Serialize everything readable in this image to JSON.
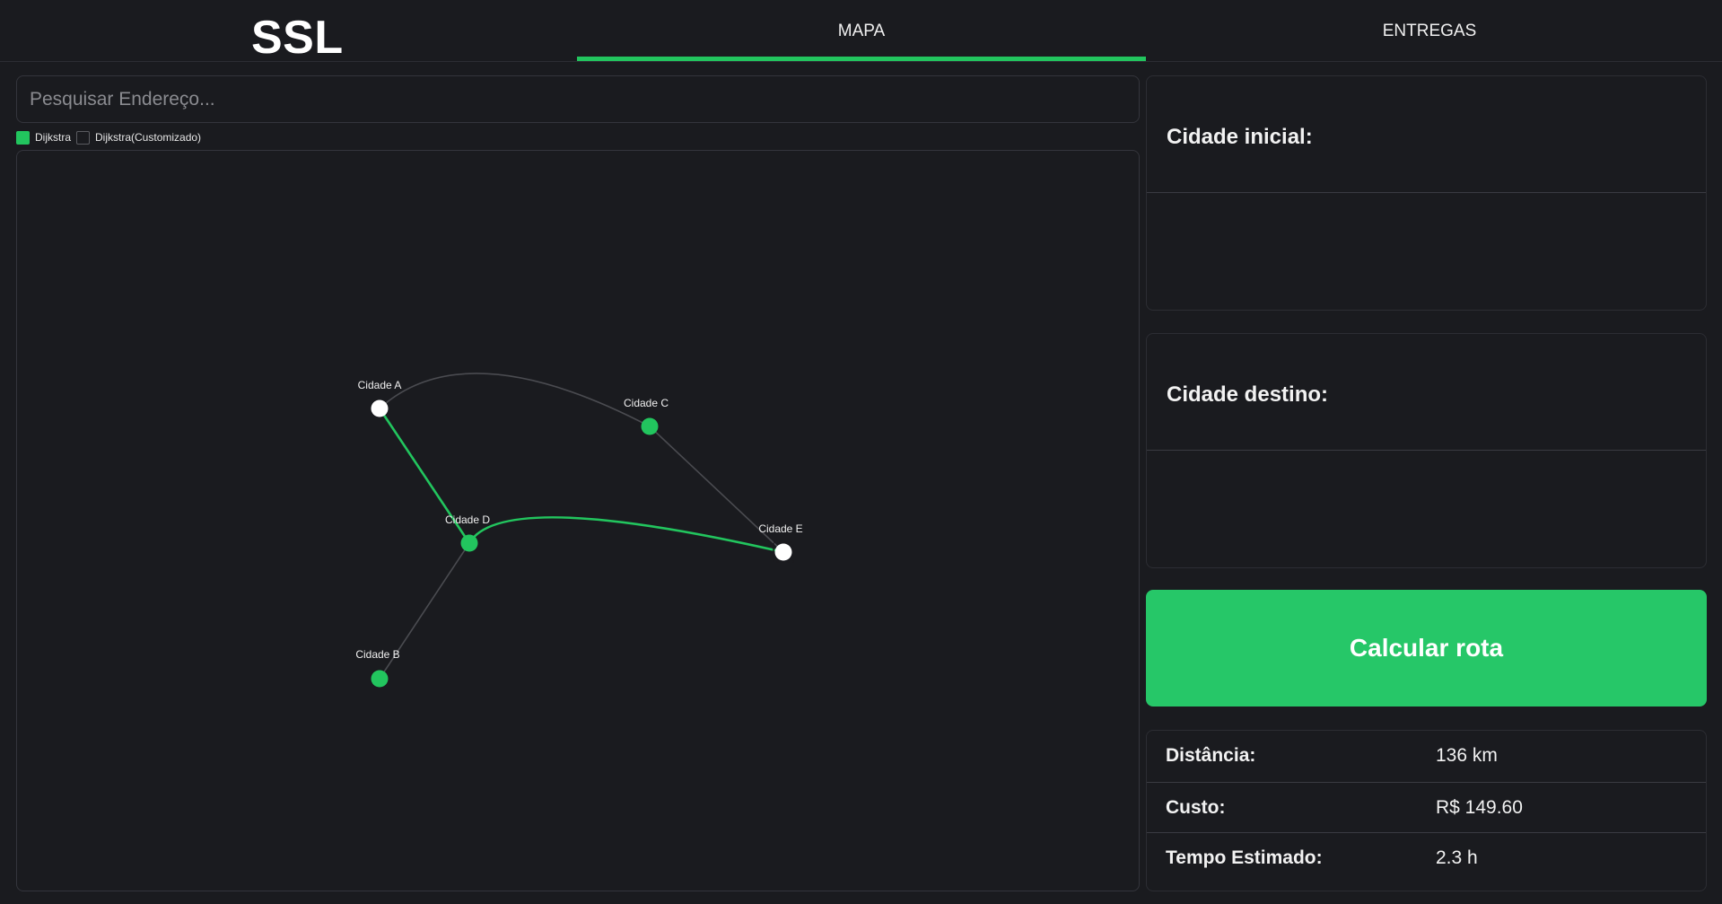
{
  "header": {
    "logo": "SSL",
    "tabs": [
      {
        "label": "MAPA",
        "active": true
      },
      {
        "label": "ENTREGAS",
        "active": false
      }
    ]
  },
  "search": {
    "placeholder": "Pesquisar Endereço...",
    "value": ""
  },
  "legend": [
    {
      "label": "Dijkstra",
      "checked": true,
      "color": "#22c55e"
    },
    {
      "label": "Dijkstra(Customizado)",
      "checked": false
    }
  ],
  "graph": {
    "nodes": [
      {
        "id": "A",
        "label": "Cidade A",
        "state": "selected"
      },
      {
        "id": "B",
        "label": "Cidade B",
        "state": "normal"
      },
      {
        "id": "C",
        "label": "Cidade C",
        "state": "normal"
      },
      {
        "id": "D",
        "label": "Cidade D",
        "state": "normal"
      },
      {
        "id": "E",
        "label": "Cidade E",
        "state": "selected-focused"
      }
    ],
    "edges": [
      {
        "from": "A",
        "to": "C",
        "on_path": false
      },
      {
        "from": "C",
        "to": "E",
        "on_path": false
      },
      {
        "from": "A",
        "to": "D",
        "on_path": true
      },
      {
        "from": "D",
        "to": "E",
        "on_path": true
      },
      {
        "from": "D",
        "to": "B",
        "on_path": false
      }
    ],
    "colors": {
      "path": "#22c55e",
      "edge": "#4a4b50",
      "node": "#22c55e",
      "selected": "#ffffff"
    }
  },
  "panel": {
    "origem_label": "Cidade inicial:",
    "origem_value": "",
    "destino_label": "Cidade destino:",
    "destino_value": "",
    "calc_button": "Calcular rota"
  },
  "stats": {
    "distancia_label": "Distância:",
    "distancia_value": "136 km",
    "custo_label": "Custo:",
    "custo_value": "R$ 149.60",
    "tempo_label": "Tempo Estimado:",
    "tempo_value": "2.3 h"
  },
  "accent": "#22c55e"
}
